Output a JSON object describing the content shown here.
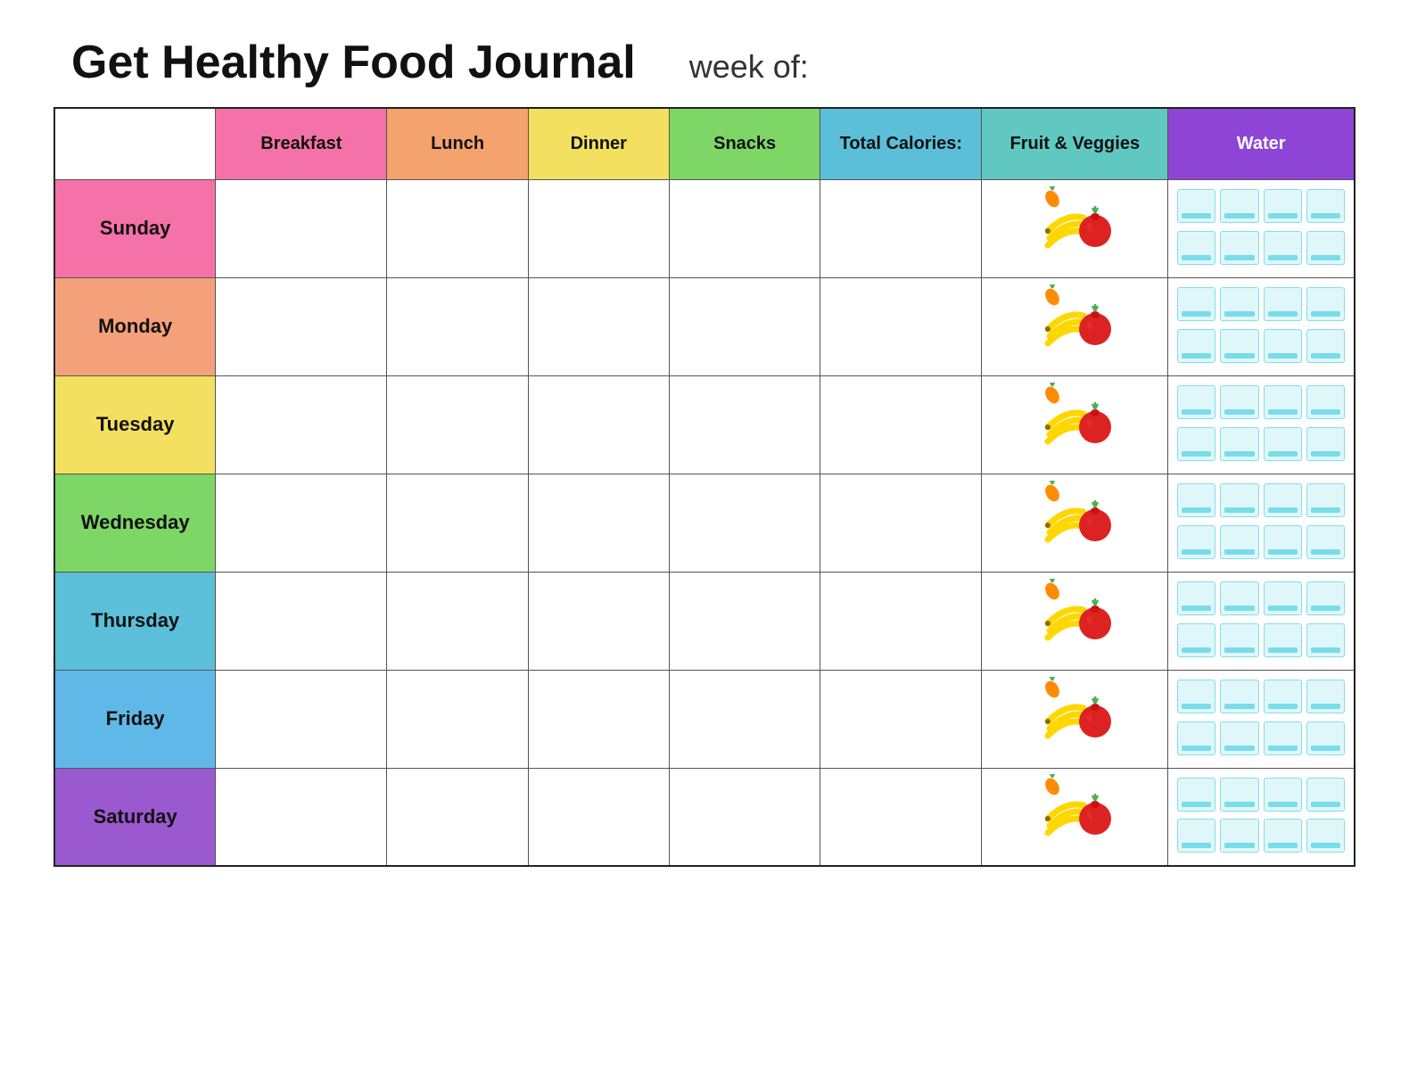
{
  "title": "Get Healthy Food Journal",
  "week_of_label": "week of:",
  "columns": {
    "empty": "",
    "breakfast": "Breakfast",
    "lunch": "Lunch",
    "dinner": "Dinner",
    "snacks": "Snacks",
    "calories": "Total Calories:",
    "fruits": "Fruit & Veggies",
    "water": "Water"
  },
  "days": [
    {
      "name": "Sunday",
      "class": "day-sunday"
    },
    {
      "name": "Monday",
      "class": "day-monday"
    },
    {
      "name": "Tuesday",
      "class": "day-tuesday"
    },
    {
      "name": "Wednesday",
      "class": "day-wednesday"
    },
    {
      "name": "Thursday",
      "class": "day-thursday"
    },
    {
      "name": "Friday",
      "class": "day-friday"
    },
    {
      "name": "Saturday",
      "class": "day-saturday"
    }
  ],
  "colors": {
    "accent_purple": "#8e44d4",
    "water_bg": "#e0f7fa",
    "water_fill": "#4dd0e1"
  }
}
